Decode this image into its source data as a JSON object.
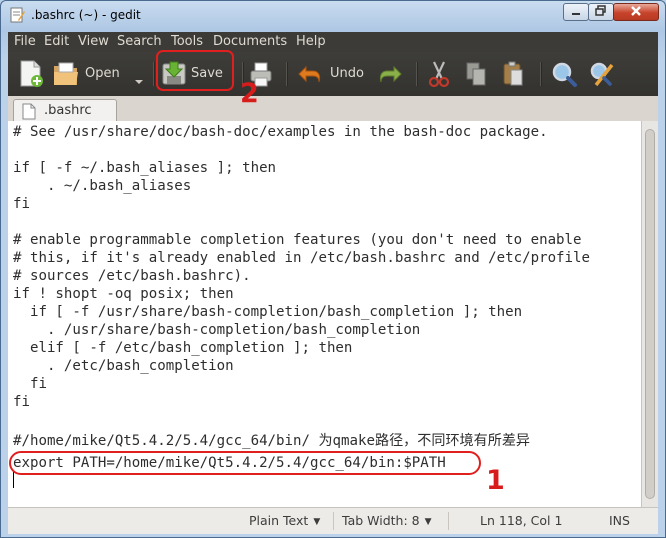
{
  "window": {
    "title": ".bashrc (~) - gedit"
  },
  "menubar": {
    "items": [
      "File",
      "Edit",
      "View",
      "Search",
      "Tools",
      "Documents",
      "Help"
    ]
  },
  "toolbar": {
    "open_label": "Open",
    "save_label": "Save",
    "undo_label": "Undo"
  },
  "annotations": {
    "save_marker": "2",
    "export_marker": "1"
  },
  "tabs": [
    {
      "label": ".bashrc"
    }
  ],
  "editor": {
    "lines": [
      "# See /usr/share/doc/bash-doc/examples in the bash-doc package.",
      "",
      "if [ -f ~/.bash_aliases ]; then",
      "    . ~/.bash_aliases",
      "fi",
      "",
      "# enable programmable completion features (you don't need to enable",
      "# this, if it's already enabled in /etc/bash.bashrc and /etc/profile",
      "# sources /etc/bash.bashrc).",
      "if ! shopt -oq posix; then",
      "  if [ -f /usr/share/bash-completion/bash_completion ]; then",
      "    . /usr/share/bash-completion/bash_completion",
      "  elif [ -f /etc/bash_completion ]; then",
      "    . /etc/bash_completion",
      "  fi",
      "fi",
      "",
      "#/home/mike/Qt5.4.2/5.4/gcc_64/bin/ 为qmake路径，不同环境有所差异",
      "export PATH=/home/mike/Qt5.4.2/5.4/gcc_64/bin:$PATH",
      ""
    ]
  },
  "statusbar": {
    "language": "Plain Text",
    "tab_width": "Tab Width: 8",
    "position": "Ln 118, Col 1",
    "mode": "INS"
  },
  "icons": {
    "new": "new-document-icon",
    "open": "open-folder-icon",
    "save": "save-icon",
    "print": "printer-icon",
    "undo": "undo-icon",
    "redo": "redo-icon",
    "cut": "scissors-icon",
    "copy": "copy-icon",
    "paste": "paste-icon",
    "find": "search-icon",
    "replace": "find-replace-icon"
  },
  "colors": {
    "annotation": "#e0201e",
    "menubar_bg": "#3c3b37",
    "undo_arrow": "#e07a1f",
    "redo_arrow": "#8ab04a"
  }
}
